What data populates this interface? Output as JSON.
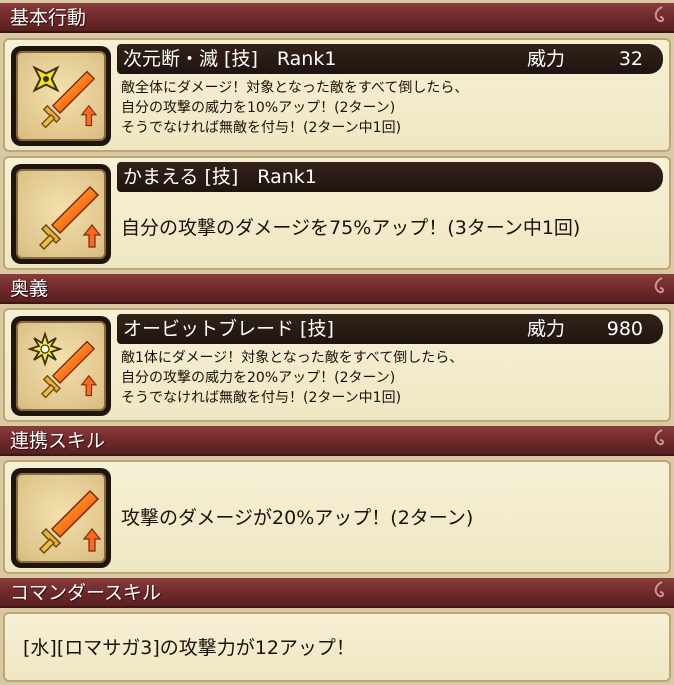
{
  "sections": {
    "basic": {
      "title": "基本行動"
    },
    "ougi": {
      "title": "奥義"
    },
    "renkei": {
      "title": "連携スキル"
    },
    "commander": {
      "title": "コマンダースキル"
    }
  },
  "skills": [
    {
      "name": "次元断・滅 [技]　Rank1",
      "power_label": "威力",
      "power_value": "32",
      "icon": "shuriken-sword-up-icon",
      "lines": [
        "敵全体にダメージ！対象となった敵をすべて倒したら、",
        "自分の攻撃の威力を10%アップ！(2ターン)",
        "そうでなければ無敵を付与！(2ターン中1回)"
      ]
    },
    {
      "name": "かまえる [技]　Rank1",
      "icon": "sword-up-icon",
      "description": "自分の攻撃のダメージを75%アップ！(3ターン中1回)"
    },
    {
      "name": "オービットブレード [技]",
      "power_label": "威力",
      "power_value": "980",
      "icon": "starburst-sword-up-icon",
      "lines": [
        "敵1体にダメージ！対象となった敵をすべて倒したら、",
        "自分の攻撃の威力を20%アップ！(2ターン)",
        "そうでなければ無敵を付与！(2ターン中1回)"
      ]
    },
    {
      "icon": "sword-up-icon",
      "description": "攻撃のダメージが20%アップ！(2ターン)"
    }
  ],
  "commander_text": "[水][ロマサガ3]の攻撃力が12アップ！",
  "colors": {
    "header": "#6e2828",
    "card": "#f3ebcc",
    "namebar": "#261a13",
    "icon_frame": "#1f1510"
  }
}
